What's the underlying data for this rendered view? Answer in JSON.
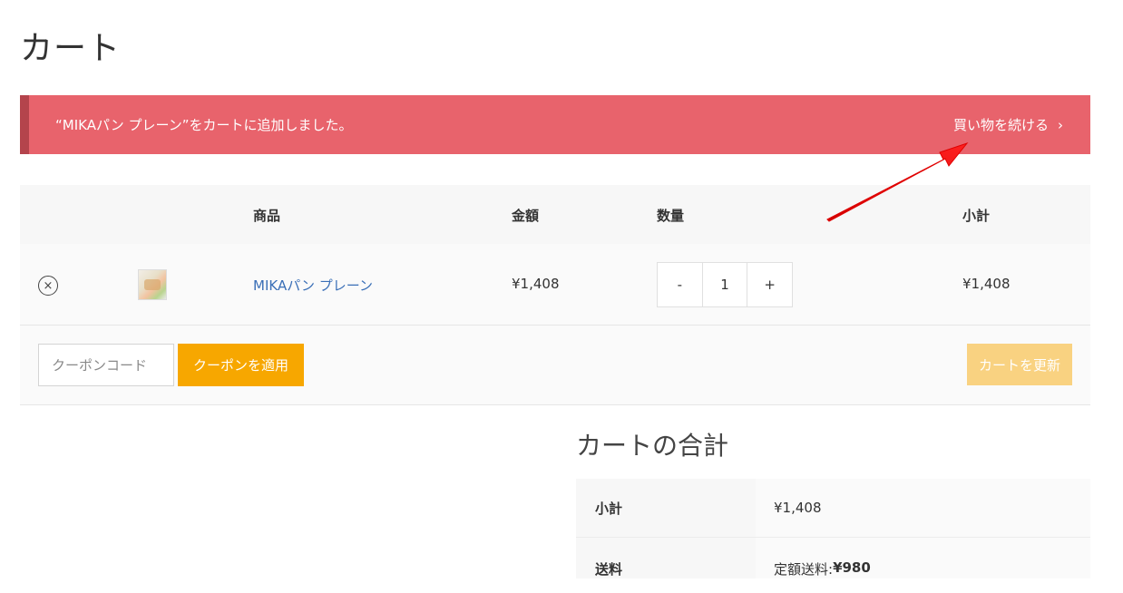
{
  "page": {
    "title": "カート"
  },
  "notice": {
    "message": "“MIKAパン プレーン”をカートに追加しました。",
    "continue_label": "買い物を続ける",
    "chevron": "›",
    "color": "#e8636c"
  },
  "cart": {
    "headers": {
      "product": "商品",
      "price": "金額",
      "quantity": "数量",
      "subtotal": "小計"
    },
    "items": [
      {
        "remove_icon": "×",
        "name": "MIKAパン プレーン",
        "price": "¥1,408",
        "qty_minus": "-",
        "qty": "1",
        "qty_plus": "+",
        "subtotal": "¥1,408"
      }
    ],
    "coupon_placeholder": "クーポンコード",
    "apply_label": "クーポンを適用",
    "update_label": "カートを更新"
  },
  "totals": {
    "title": "カートの合計",
    "subtotal_label": "小計",
    "subtotal_value": "¥1,408",
    "shipping_label": "送料",
    "shipping_prefix": "定額送料: ",
    "shipping_value": "¥980"
  },
  "colors": {
    "accent": "#f7a700",
    "link": "#3a6fb7",
    "annotation_arrow": "#ff0000"
  }
}
